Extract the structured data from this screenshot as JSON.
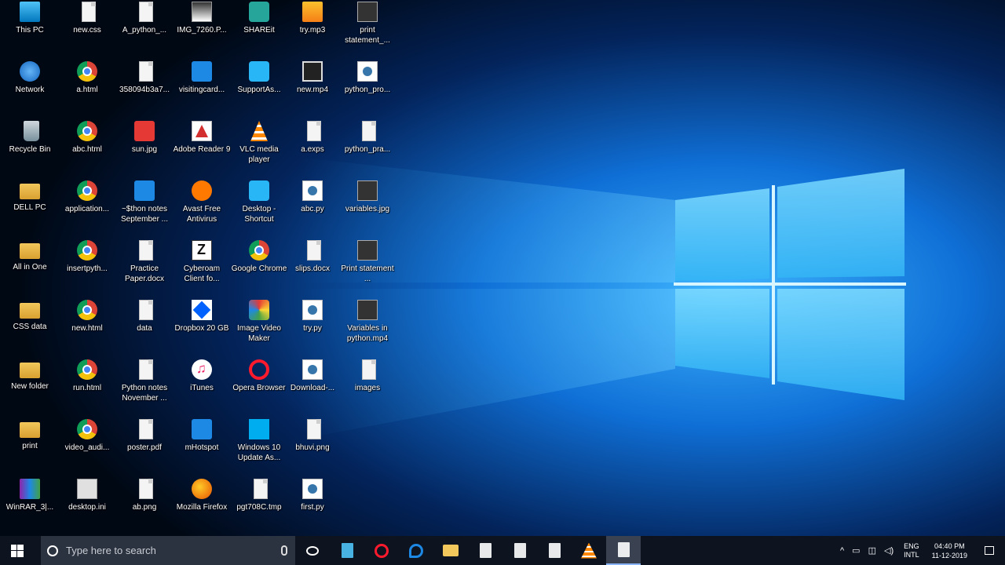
{
  "desktop": {
    "icons": [
      {
        "label": "This PC",
        "icon": "computer-icon",
        "style": "pc"
      },
      {
        "label": "Network",
        "icon": "network-icon",
        "style": "net"
      },
      {
        "label": "Recycle Bin",
        "icon": "recycle-bin-icon",
        "style": "bin"
      },
      {
        "label": "DELL PC",
        "icon": "folder-icon",
        "style": "folder"
      },
      {
        "label": "All in One",
        "icon": "folder-icon",
        "style": "folder"
      },
      {
        "label": "CSS data",
        "icon": "folder-icon",
        "style": "folder"
      },
      {
        "label": "New folder",
        "icon": "folder-icon",
        "style": "folder"
      },
      {
        "label": "print",
        "icon": "folder-icon",
        "style": "folder"
      },
      {
        "label": "WinRAR_3|...",
        "icon": "winrar-icon",
        "style": "winrar"
      },
      {
        "label": "new.css",
        "icon": "document-icon",
        "style": "doc"
      },
      {
        "label": "a.html",
        "icon": "chrome-icon",
        "style": "chrome"
      },
      {
        "label": "abc.html",
        "icon": "chrome-icon",
        "style": "chrome"
      },
      {
        "label": "application...",
        "icon": "chrome-icon",
        "style": "chrome"
      },
      {
        "label": "insertpyth...",
        "icon": "chrome-icon",
        "style": "chrome"
      },
      {
        "label": "new.html",
        "icon": "chrome-icon",
        "style": "chrome"
      },
      {
        "label": "run.html",
        "icon": "chrome-icon",
        "style": "chrome"
      },
      {
        "label": "video_audi...",
        "icon": "chrome-icon",
        "style": "chrome"
      },
      {
        "label": "desktop.ini",
        "icon": "settings-file-icon",
        "style": "ini"
      },
      {
        "label": "A_python_...",
        "icon": "document-icon",
        "style": "doc"
      },
      {
        "label": "358094b3a7...",
        "icon": "document-icon",
        "style": "doc"
      },
      {
        "label": "sun.jpg",
        "icon": "image-icon",
        "style": "red"
      },
      {
        "label": "~$thon notes September ...",
        "icon": "word-document-icon",
        "style": "blue"
      },
      {
        "label": "Practice Paper.docx",
        "icon": "word-document-icon",
        "style": "doc"
      },
      {
        "label": "data",
        "icon": "document-icon",
        "style": "doc"
      },
      {
        "label": "Python notes November ...",
        "icon": "word-document-icon",
        "style": "doc"
      },
      {
        "label": "poster.pdf",
        "icon": "pdf-icon",
        "style": "doc"
      },
      {
        "label": "ab.png",
        "icon": "image-icon",
        "style": "doc"
      },
      {
        "label": "IMG_7260.P...",
        "icon": "image-icon",
        "style": "photo"
      },
      {
        "label": "visitingcard...",
        "icon": "image-icon",
        "style": "blue"
      },
      {
        "label": "Adobe Reader 9",
        "icon": "adobe-reader-icon",
        "style": "pdf"
      },
      {
        "label": "Avast Free Antivirus",
        "icon": "avast-icon",
        "style": "avast"
      },
      {
        "label": "Cyberoam Client fo...",
        "icon": "cyberoam-icon",
        "style": "cyber"
      },
      {
        "label": "Dropbox 20 GB",
        "icon": "dropbox-icon",
        "style": "dropbox"
      },
      {
        "label": "iTunes",
        "icon": "itunes-icon",
        "style": "itunes"
      },
      {
        "label": "mHotspot",
        "icon": "hotspot-icon",
        "style": "hotspot"
      },
      {
        "label": "Mozilla Firefox",
        "icon": "firefox-icon",
        "style": "firefox"
      },
      {
        "label": "SHAREit",
        "icon": "shareit-icon",
        "style": "share"
      },
      {
        "label": "SupportAs...",
        "icon": "support-assist-icon",
        "style": "cyan"
      },
      {
        "label": "VLC media player",
        "icon": "vlc-icon",
        "style": "vlc"
      },
      {
        "label": "Desktop - Shortcut",
        "icon": "desktop-shortcut-icon",
        "style": "cyan"
      },
      {
        "label": "Google Chrome",
        "icon": "chrome-icon",
        "style": "chrome"
      },
      {
        "label": "Image Video Maker",
        "icon": "image-video-maker-icon",
        "style": "imgvid"
      },
      {
        "label": "Opera Browser",
        "icon": "opera-icon",
        "style": "opera"
      },
      {
        "label": "Windows 10 Update As...",
        "icon": "windows-update-icon",
        "style": "win"
      },
      {
        "label": "pgt708C.tmp",
        "icon": "document-icon",
        "style": "doc"
      },
      {
        "label": "try.mp3",
        "icon": "audio-file-icon",
        "style": "mp3"
      },
      {
        "label": "new.mp4",
        "icon": "video-file-icon",
        "style": "video"
      },
      {
        "label": "a.exps",
        "icon": "document-icon",
        "style": "doc"
      },
      {
        "label": "abc.py",
        "icon": "python-file-icon",
        "style": "py"
      },
      {
        "label": "slips.docx",
        "icon": "word-document-icon",
        "style": "doc"
      },
      {
        "label": "try.py",
        "icon": "python-file-icon",
        "style": "py"
      },
      {
        "label": "Download-...",
        "icon": "document-icon",
        "style": "py"
      },
      {
        "label": "bhuvi.png",
        "icon": "image-icon",
        "style": "doc"
      },
      {
        "label": "first.py",
        "icon": "python-file-icon",
        "style": "py"
      },
      {
        "label": "print statement_...",
        "icon": "video-file-icon",
        "style": "dark"
      },
      {
        "label": "python_pro...",
        "icon": "document-icon",
        "style": "py"
      },
      {
        "label": "python_pra...",
        "icon": "word-document-icon",
        "style": "doc"
      },
      {
        "label": "variables.jpg",
        "icon": "image-icon",
        "style": "dark"
      },
      {
        "label": "Print statement ...",
        "icon": "video-file-icon",
        "style": "dark"
      },
      {
        "label": "Variables in python.mp4",
        "icon": "video-file-icon",
        "style": "dark"
      },
      {
        "label": "images",
        "icon": "image-icon",
        "style": "doc"
      }
    ]
  },
  "taskbar": {
    "search_placeholder": "Type here to search",
    "pinned": [
      {
        "name": "task-view-icon",
        "color": "#ffffff"
      },
      {
        "name": "store-app-icon",
        "color": "#4fc3f7"
      },
      {
        "name": "opera-icon",
        "color": "#ff1b2d"
      },
      {
        "name": "edge-icon",
        "color": "#1e88e5"
      },
      {
        "name": "file-explorer-icon",
        "color": "#f2c75c"
      },
      {
        "name": "store-bag-icon",
        "color": "#ffffff"
      },
      {
        "name": "document-icon",
        "color": "#ffffff"
      },
      {
        "name": "notepad-icon",
        "color": "#ffffff"
      },
      {
        "name": "vlc-icon",
        "color": "#ff8800"
      },
      {
        "name": "paint-icon",
        "color": "#ffffff"
      }
    ],
    "tray": {
      "chevron": "^",
      "lang_top": "ENG",
      "lang_bottom": "INTL",
      "time": "04:40 PM",
      "date": "11-12-2019"
    }
  },
  "colors": {
    "wallpaper_blue": "#1a8fe0",
    "wallpaper_light": "#9be6ff",
    "taskbar": "#0d1420"
  }
}
